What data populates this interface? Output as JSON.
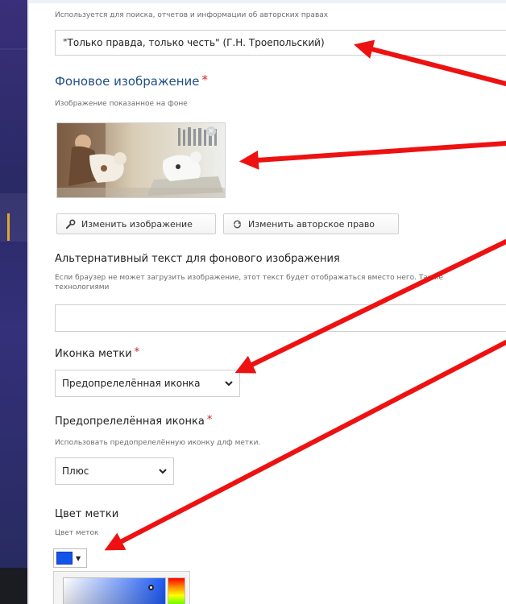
{
  "window": {
    "title": ""
  },
  "copyright_field": {
    "description": "Используется для поиска, отчетов и информации об авторских правах",
    "value": "\"Только правда, только честь\" (Г.Н. Троепольский)"
  },
  "background_image": {
    "label": "Фоновое изображение",
    "required_mark": "*",
    "description": "Изображение показанное на фоне",
    "remove_label": "×",
    "change_image_label": "Изменить изображение",
    "change_copyright_label": "Изменить авторское право"
  },
  "alt_text": {
    "label": "Альтернативный текст для фонового изображения",
    "description_line1": "Если браузер не может загрузить изображение, этот текст будет отображаться вместо него. Также",
    "description_line2": "технологиями",
    "value": ""
  },
  "marker_icon": {
    "label": "Иконка метки",
    "required_mark": "*",
    "selected": "Предопрелелённая иконка"
  },
  "predefined_icon": {
    "label": "Предопрелелённая иконка",
    "required_mark": "*",
    "description": "Использовать предопрелелённую иконку длф метки.",
    "selected": "Плюс"
  },
  "marker_color": {
    "label": "Цвет метки",
    "description": "Цвет меток",
    "caret": "▼",
    "value": "#1554e8"
  },
  "colors": {
    "annotation_arrow": "#ee1111",
    "heading": "#1f4f82",
    "required": "#cc2222"
  },
  "icons": [
    "close-icon",
    "wrench-icon",
    "recycle-icon",
    "chevron-down-icon",
    "caret-down-icon"
  ]
}
